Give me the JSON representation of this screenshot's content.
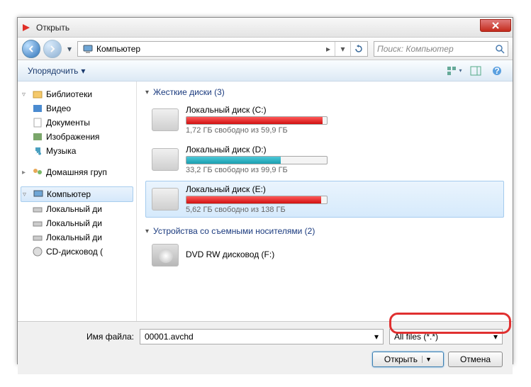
{
  "titlebar": {
    "title": "Открыть"
  },
  "nav": {
    "location": "Компьютер",
    "search_placeholder": "Поиск: Компьютер"
  },
  "toolbar": {
    "organize": "Упорядочить"
  },
  "sidebar": {
    "libraries": {
      "label": "Библиотеки",
      "items": [
        "Видео",
        "Документы",
        "Изображения",
        "Музыка"
      ]
    },
    "homegroup": "Домашняя груп",
    "computer": {
      "label": "Компьютер",
      "items": [
        "Локальный ди",
        "Локальный ди",
        "Локальный ди",
        "CD-дисковод ("
      ]
    }
  },
  "content": {
    "hdd_section": {
      "title": "Жесткие диски (3)",
      "drives": [
        {
          "name": "Локальный диск (C:)",
          "free": "1,72 ГБ свободно из 59,9 ГБ",
          "fill_pct": 97,
          "color": "red"
        },
        {
          "name": "Локальный диск (D:)",
          "free": "33,2 ГБ свободно из 99,9 ГБ",
          "fill_pct": 67,
          "color": "teal"
        },
        {
          "name": "Локальный диск (E:)",
          "free": "5,62 ГБ свободно из 138 ГБ",
          "fill_pct": 96,
          "color": "red",
          "selected": true
        }
      ]
    },
    "removable_section": {
      "title": "Устройства со съемными носителями (2)",
      "drives": [
        {
          "name": "DVD RW дисковод (F:)"
        }
      ]
    }
  },
  "footer": {
    "filename_label": "Имя файла:",
    "filename_value": "00001.avchd",
    "filetype": "All files (*.*)",
    "open_btn": "Открыть",
    "cancel_btn": "Отмена"
  }
}
